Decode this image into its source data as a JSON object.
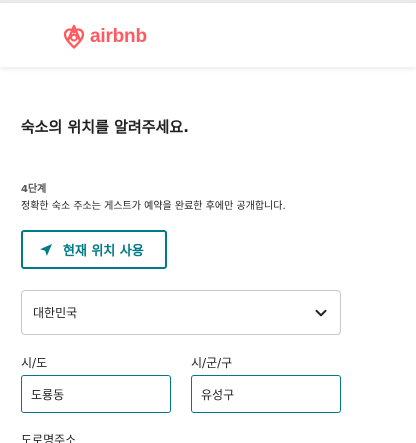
{
  "header": {
    "logo_text": "airbnb",
    "brand_color": "#ff5a5f",
    "logo_icon": "airbnb-belo-icon"
  },
  "main": {
    "title": "숙소의 위치를 알려주세요.",
    "step_label": "4단계",
    "description": "정확한 숙소 주소는 게스트가 예약을 완료한 후에만 공개합니다.",
    "accent_color": "#007a87"
  },
  "location_button": {
    "label": "현재 위치 사용",
    "icon": "navigation-arrow-icon"
  },
  "country": {
    "selected": "대한민국",
    "icon": "chevron-down-icon"
  },
  "fields": {
    "state_label": "시/도",
    "state_value": "도룡동",
    "city_label": "시/군/구",
    "city_value": "유성구",
    "street_label": "도로명주소"
  }
}
